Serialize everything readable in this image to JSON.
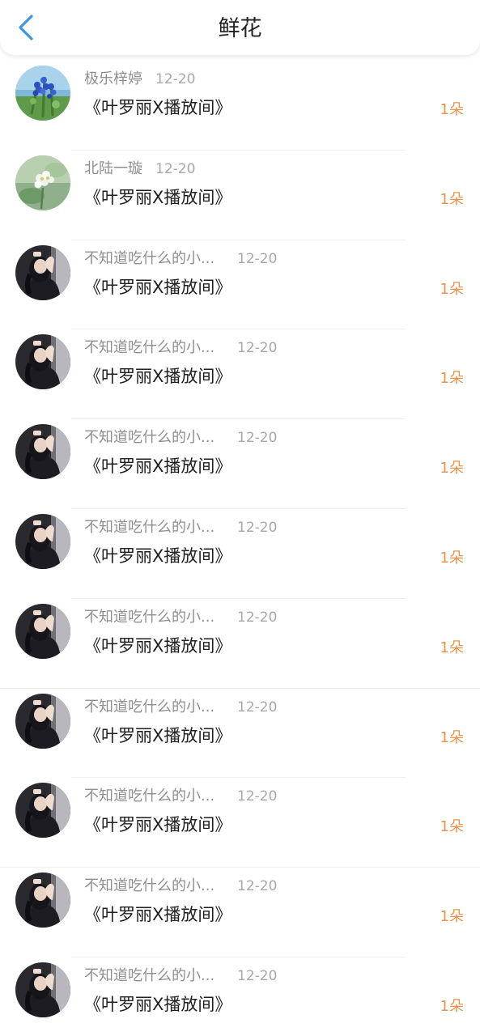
{
  "header": {
    "title": "鲜花",
    "back_icon": "chevron-left-icon",
    "accent_color": "#3a95e8"
  },
  "list": [
    {
      "name": "极乐梓婷",
      "date": "12-20",
      "room": "《叶罗丽X播放间》",
      "count": "1朵",
      "avatar": "blue-flowers"
    },
    {
      "name": "北陆一璇",
      "date": "12-20",
      "room": "《叶罗丽X播放间》",
      "count": "1朵",
      "avatar": "white-flowers"
    },
    {
      "name": "不知道吃什么的小...",
      "date": "12-20",
      "room": "《叶罗丽X播放间》",
      "count": "1朵",
      "avatar": "girl-photo"
    },
    {
      "name": "不知道吃什么的小...",
      "date": "12-20",
      "room": "《叶罗丽X播放间》",
      "count": "1朵",
      "avatar": "girl-photo"
    },
    {
      "name": "不知道吃什么的小...",
      "date": "12-20",
      "room": "《叶罗丽X播放间》",
      "count": "1朵",
      "avatar": "girl-photo"
    },
    {
      "name": "不知道吃什么的小...",
      "date": "12-20",
      "room": "《叶罗丽X播放间》",
      "count": "1朵",
      "avatar": "girl-photo"
    },
    {
      "name": "不知道吃什么的小...",
      "date": "12-20",
      "room": "《叶罗丽X播放间》",
      "count": "1朵",
      "avatar": "girl-photo"
    },
    {
      "name": "不知道吃什么的小...",
      "date": "12-20",
      "room": "《叶罗丽X播放间》",
      "count": "1朵",
      "avatar": "girl-photo"
    },
    {
      "name": "不知道吃什么的小...",
      "date": "12-20",
      "room": "《叶罗丽X播放间》",
      "count": "1朵",
      "avatar": "girl-photo"
    },
    {
      "name": "不知道吃什么的小...",
      "date": "12-20",
      "room": "《叶罗丽X播放间》",
      "count": "1朵",
      "avatar": "girl-photo"
    },
    {
      "name": "不知道吃什么的小...",
      "date": "12-20",
      "room": "《叶罗丽X播放间》",
      "count": "1朵",
      "avatar": "girl-photo"
    }
  ]
}
